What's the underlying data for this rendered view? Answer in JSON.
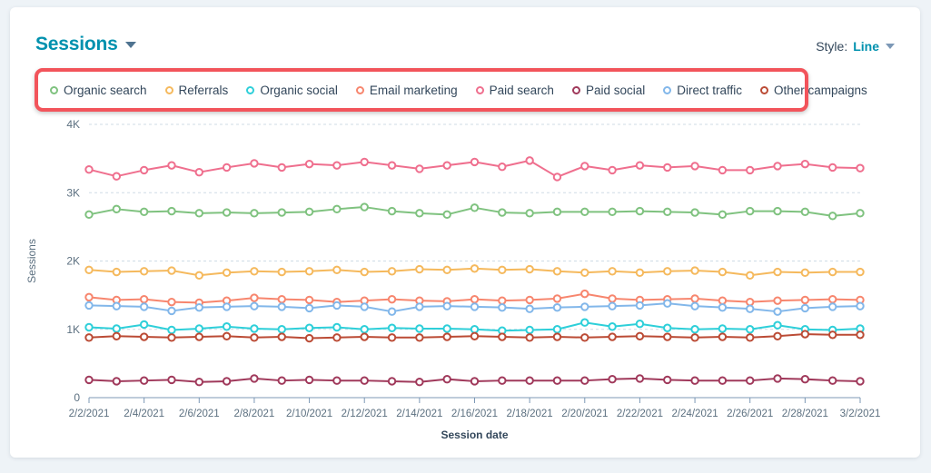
{
  "card": {
    "title": "Sessions",
    "title_caret": "chevron-down-icon",
    "style": {
      "label": "Style:",
      "value": "Line",
      "caret": "chevron-down-icon"
    }
  },
  "legend": {
    "highlight_color": "#f2545b",
    "items": [
      {
        "label": "Organic search",
        "color": "#7fc27f"
      },
      {
        "label": "Referrals",
        "color": "#f5b95d"
      },
      {
        "label": "Organic social",
        "color": "#2ecfd9"
      },
      {
        "label": "Email marketing",
        "color": "#f7866e"
      },
      {
        "label": "Paid search",
        "color": "#ef6f8e"
      },
      {
        "label": "Paid social",
        "color": "#a0395b"
      },
      {
        "label": "Direct traffic",
        "color": "#82b7ea"
      },
      {
        "label": "Other campaigns",
        "color": "#bb4b35"
      }
    ]
  },
  "chart_data": {
    "type": "line",
    "title": "Sessions",
    "xlabel": "Session date",
    "ylabel": "Sessions",
    "ylim": [
      0,
      4000
    ],
    "yticks": [
      0,
      1000,
      2000,
      3000,
      4000
    ],
    "yticklabels": [
      "0",
      "1K",
      "2K",
      "3K",
      "4K"
    ],
    "grid": true,
    "legend_position": "top",
    "x": [
      "2/2/2021",
      "2/3/2021",
      "2/4/2021",
      "2/5/2021",
      "2/6/2021",
      "2/7/2021",
      "2/8/2021",
      "2/9/2021",
      "2/10/2021",
      "2/11/2021",
      "2/12/2021",
      "2/13/2021",
      "2/14/2021",
      "2/15/2021",
      "2/16/2021",
      "2/17/2021",
      "2/18/2021",
      "2/19/2021",
      "2/20/2021",
      "2/21/2021",
      "2/22/2021",
      "2/23/2021",
      "2/24/2021",
      "2/25/2021",
      "2/26/2021",
      "2/27/2021",
      "2/28/2021",
      "3/1/2021",
      "3/2/2021"
    ],
    "xticklabels": [
      "2/2/2021",
      "2/4/2021",
      "2/6/2021",
      "2/8/2021",
      "2/10/2021",
      "2/12/2021",
      "2/14/2021",
      "2/16/2021",
      "2/18/2021",
      "2/20/2021",
      "2/22/2021",
      "2/24/2021",
      "2/26/2021",
      "2/28/2021",
      "3/2/2021"
    ],
    "series": [
      {
        "name": "Paid search",
        "color": "#ef6f8e",
        "values": [
          3340,
          3240,
          3330,
          3400,
          3300,
          3370,
          3430,
          3370,
          3420,
          3400,
          3450,
          3400,
          3350,
          3400,
          3450,
          3380,
          3470,
          3230,
          3390,
          3330,
          3400,
          3370,
          3390,
          3330,
          3330,
          3390,
          3420,
          3370,
          3360
        ]
      },
      {
        "name": "Organic search",
        "color": "#7fc27f",
        "values": [
          2680,
          2760,
          2720,
          2730,
          2700,
          2710,
          2700,
          2710,
          2720,
          2760,
          2790,
          2730,
          2700,
          2680,
          2780,
          2710,
          2700,
          2720,
          2720,
          2720,
          2730,
          2720,
          2710,
          2680,
          2730,
          2730,
          2720,
          2660,
          2700
        ]
      },
      {
        "name": "Referrals",
        "color": "#f5b95d",
        "values": [
          1870,
          1840,
          1850,
          1860,
          1790,
          1830,
          1850,
          1840,
          1850,
          1870,
          1840,
          1850,
          1880,
          1870,
          1890,
          1870,
          1880,
          1850,
          1830,
          1850,
          1830,
          1850,
          1860,
          1840,
          1790,
          1840,
          1830,
          1840,
          1840
        ]
      },
      {
        "name": "Email marketing",
        "color": "#f7866e",
        "values": [
          1470,
          1430,
          1440,
          1400,
          1390,
          1420,
          1460,
          1440,
          1430,
          1400,
          1420,
          1440,
          1420,
          1410,
          1440,
          1420,
          1430,
          1450,
          1520,
          1450,
          1430,
          1440,
          1450,
          1420,
          1400,
          1420,
          1430,
          1440,
          1430
        ]
      },
      {
        "name": "Direct traffic",
        "color": "#82b7ea",
        "values": [
          1350,
          1340,
          1330,
          1270,
          1320,
          1330,
          1340,
          1330,
          1310,
          1350,
          1330,
          1260,
          1330,
          1340,
          1330,
          1320,
          1300,
          1320,
          1330,
          1340,
          1350,
          1380,
          1340,
          1320,
          1300,
          1260,
          1310,
          1330,
          1340
        ]
      },
      {
        "name": "Organic social",
        "color": "#2ecfd9",
        "values": [
          1030,
          1010,
          1070,
          990,
          1010,
          1040,
          1010,
          1000,
          1020,
          1030,
          1000,
          1020,
          1010,
          1010,
          1000,
          980,
          990,
          1000,
          1100,
          1040,
          1080,
          1020,
          1000,
          1010,
          1000,
          1060,
          1000,
          990,
          1010
        ]
      },
      {
        "name": "Other campaigns",
        "color": "#bb4b35",
        "values": [
          880,
          900,
          890,
          880,
          890,
          900,
          880,
          890,
          870,
          880,
          890,
          880,
          880,
          890,
          900,
          890,
          880,
          890,
          880,
          890,
          900,
          890,
          880,
          890,
          880,
          900,
          930,
          920,
          920
        ]
      },
      {
        "name": "Paid social",
        "color": "#a0395b",
        "values": [
          260,
          240,
          250,
          260,
          230,
          240,
          280,
          250,
          260,
          250,
          250,
          240,
          230,
          270,
          240,
          250,
          250,
          250,
          250,
          270,
          280,
          260,
          250,
          250,
          250,
          280,
          270,
          250,
          240
        ]
      }
    ]
  }
}
